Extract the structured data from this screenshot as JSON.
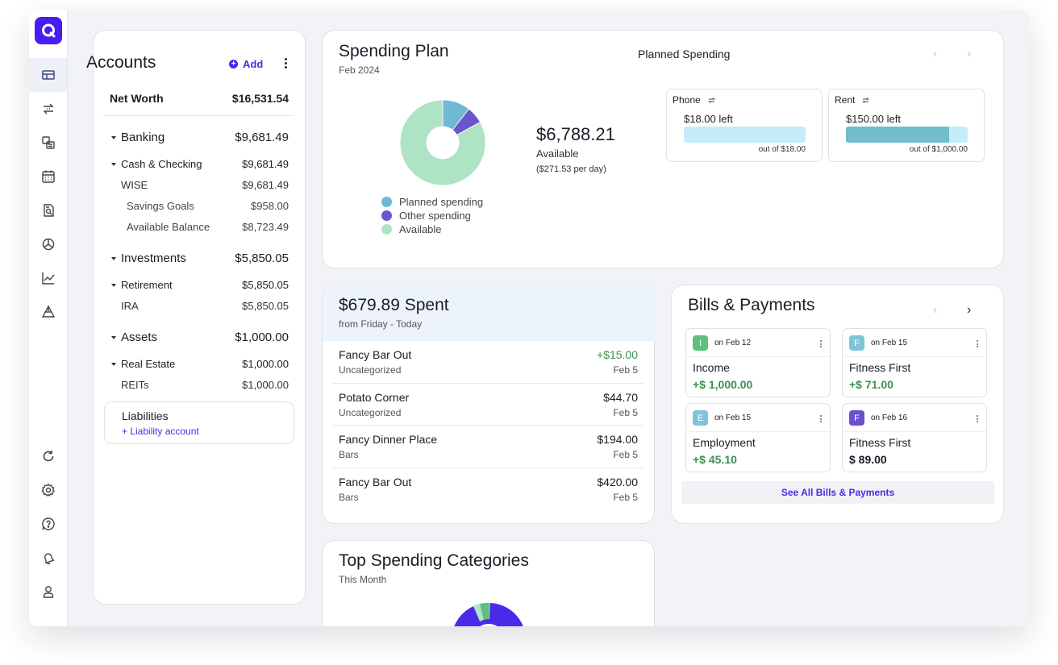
{
  "colors": {
    "accent": "#4a2ae8",
    "brand": "#471cf5",
    "positive": "#3c8f52",
    "planned": "#6eb9d4",
    "other": "#6b55cf",
    "available": "#aee4c4",
    "bar_fill": "#72bccc",
    "bar_track": "#c5ecfa"
  },
  "nav": {
    "top": [
      "dashboard-icon",
      "transactions-icon",
      "accounts-icon",
      "calendar-icon",
      "reports-icon",
      "spending-icon",
      "investments-icon",
      "planning-icon"
    ],
    "bottom": [
      "refresh-icon",
      "settings-icon",
      "help-icon",
      "notifications-icon",
      "profile-icon"
    ]
  },
  "accounts": {
    "title": "Accounts",
    "add_label": "Add",
    "net_worth_label": "Net Worth",
    "net_worth_value": "$16,531.54",
    "banking_label": "Banking",
    "banking_value": "$9,681.49",
    "cash_label": "Cash & Checking",
    "cash_value": "$9,681.49",
    "wise_label": "WISE",
    "wise_value": "$9,681.49",
    "savings_label": "Savings Goals",
    "savings_value": "$958.00",
    "avail_bal_label": "Available Balance",
    "avail_bal_value": "$8,723.49",
    "investments_label": "Investments",
    "investments_value": "$5,850.05",
    "retirement_label": "Retirement",
    "retirement_value": "$5,850.05",
    "ira_label": "IRA",
    "ira_value": "$5,850.05",
    "assets_label": "Assets",
    "assets_value": "$1,000.00",
    "real_estate_label": "Real Estate",
    "real_estate_value": "$1,000.00",
    "reits_label": "REITs",
    "reits_value": "$1,000.00",
    "liabilities_label": "Liabilities",
    "liability_link": "+ Liability account"
  },
  "spending_plan": {
    "title": "Spending Plan",
    "period": "Feb 2024",
    "center_label": "Planned Spending",
    "available_amount": "$6,788.21",
    "available_label": "Available",
    "per_day": "($271.53 per day)",
    "legend": [
      "Planned spending",
      "Other spending",
      "Available"
    ],
    "donut": {
      "planned_pct": 10.5,
      "other_pct": 6.5,
      "available_pct": 83
    },
    "budgets": [
      {
        "name": "Phone",
        "left": "$18.00 left",
        "out_of": "out of $18.00",
        "spent_fraction": 0
      },
      {
        "name": "Rent",
        "left": "$150.00 left",
        "out_of": "out of $1,000.00",
        "spent_fraction": 0.85
      }
    ]
  },
  "spent": {
    "title": "$679.89 Spent",
    "subtitle": "from Friday - Today",
    "transactions": [
      {
        "name": "Fancy Bar Out",
        "category": "Uncategorized",
        "amount": "+$15.00",
        "date": "Feb 5"
      },
      {
        "name": "Potato Corner",
        "category": "Uncategorized",
        "amount": "$44.70",
        "date": "Feb 5"
      },
      {
        "name": "Fancy Dinner Place",
        "category": "Bars",
        "amount": "$194.00",
        "date": "Feb 5"
      },
      {
        "name": "Fancy Bar Out",
        "category": "Bars",
        "amount": "$420.00",
        "date": "Feb 5"
      }
    ]
  },
  "bills": {
    "title": "Bills & Payments",
    "see_all": "See All Bills & Payments",
    "items": [
      {
        "initial": "I",
        "date": "on Feb 12",
        "name": "Income",
        "amount": "+$ 1,000.00",
        "color": "#5fbf7c"
      },
      {
        "initial": "F",
        "date": "on Feb 15",
        "name": "Fitness First",
        "amount": "+$ 71.00",
        "color": "#7ec4d8"
      },
      {
        "initial": "E",
        "date": "on Feb 15",
        "name": "Employment",
        "amount": "+$ 45.10",
        "color": "#7ec4d8"
      },
      {
        "initial": "F",
        "date": "on Feb 16",
        "name": "Fitness First",
        "amount": "$ 89.00",
        "color": "#6a4fcf"
      }
    ]
  },
  "top_categories": {
    "title": "Top Spending Categories",
    "subtitle": "This Month"
  }
}
